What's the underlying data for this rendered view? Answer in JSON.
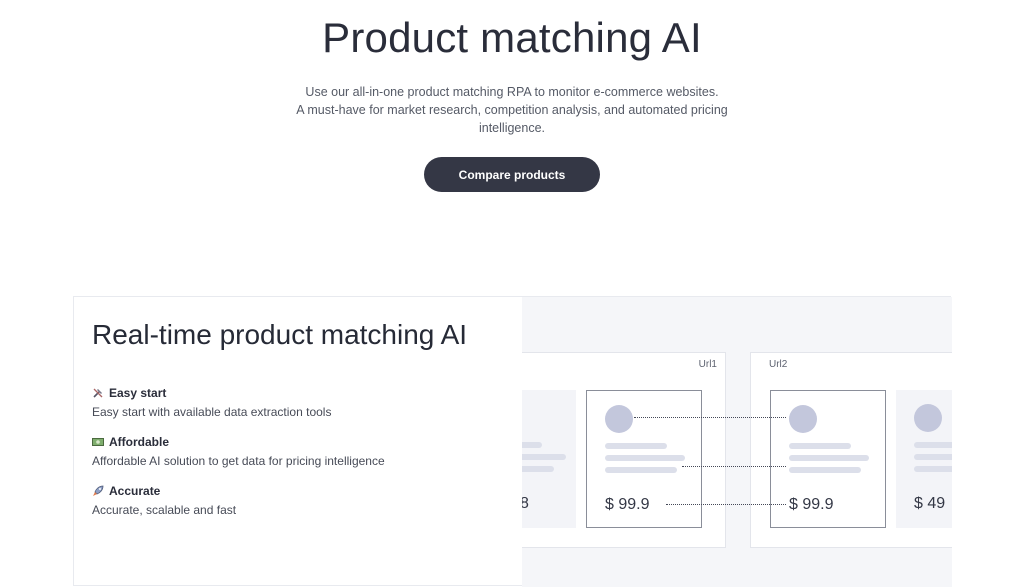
{
  "hero": {
    "title": "Product matching AI",
    "subtitle_line1": "Use our all-in-one product matching RPA to monitor e-commerce websites.",
    "subtitle_line2": "A must-have for market research, competition analysis, and automated pricing",
    "subtitle_line3": "intelligence.",
    "cta_label": "Compare products"
  },
  "feature": {
    "heading": "Real-time product matching AI",
    "items": [
      {
        "icon": "tools-icon",
        "title": "Easy start",
        "desc": "Easy start with available data extraction tools"
      },
      {
        "icon": "money-icon",
        "title": "Affordable",
        "desc": "Affordable AI solution to get data for pricing intelligence"
      },
      {
        "icon": "rocket-icon",
        "title": "Accurate",
        "desc": "Accurate, scalable and fast"
      }
    ]
  },
  "illustration": {
    "url1_label": "Url1",
    "url2_label": "Url2",
    "cards": [
      {
        "price": "8"
      },
      {
        "price": "$ 99.9"
      },
      {
        "price": "$ 99.9"
      },
      {
        "price": "$ 49"
      }
    ]
  },
  "colors": {
    "cta_bg": "#343745",
    "avatar": "#c3c7dc",
    "placeholder_line": "#dcdfea",
    "illustration_bg": "#f5f6f9"
  }
}
